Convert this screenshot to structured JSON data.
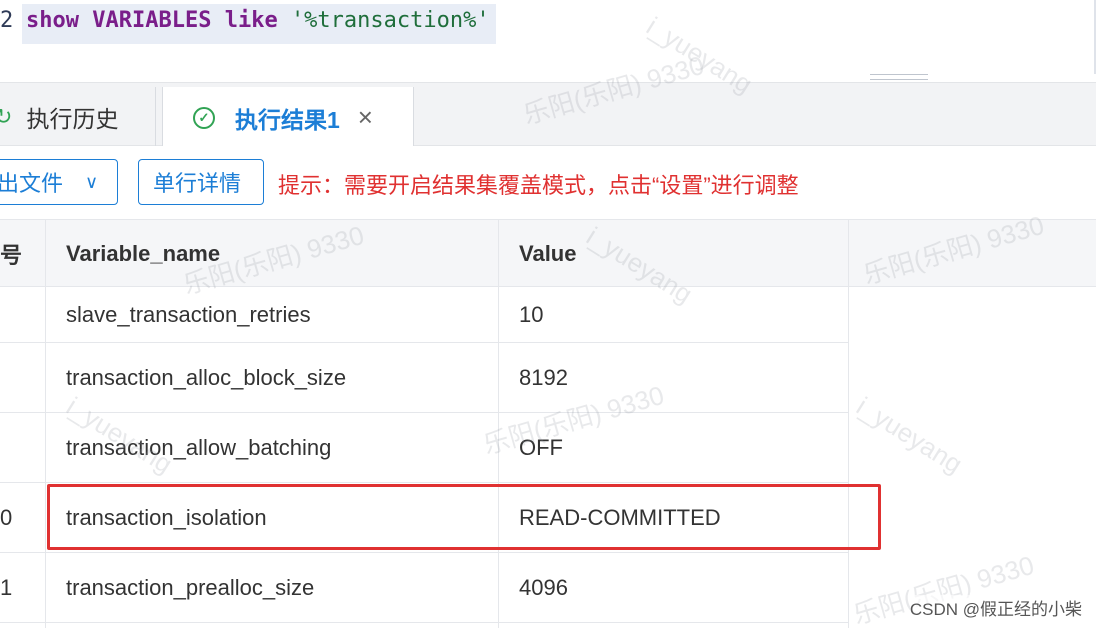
{
  "editor": {
    "line_number": "2",
    "code_keyword1": "show",
    "code_keyword2": "VARIABLES",
    "code_keyword3": "like",
    "code_string": "'%transaction%'"
  },
  "tabs": [
    {
      "label": "执行历史",
      "icon": "refresh-icon",
      "active": false
    },
    {
      "label": "执行结果1",
      "icon": "check-circle-icon",
      "active": true
    }
  ],
  "toolbar": {
    "export_label": "出文件",
    "detail_label": "单行详情",
    "hint": "提示：需要开启结果集覆盖模式，点击“设置”进行调整"
  },
  "table": {
    "columns": [
      "号",
      "Variable_name",
      "Value"
    ],
    "rows": [
      {
        "index": "",
        "name": "slave_transaction_retries",
        "value": "10"
      },
      {
        "index": "",
        "name": "transaction_alloc_block_size",
        "value": "8192"
      },
      {
        "index": "",
        "name": "transaction_allow_batching",
        "value": "OFF"
      },
      {
        "index": "0",
        "name": "transaction_isolation",
        "value": "READ-COMMITTED"
      },
      {
        "index": "1",
        "name": "transaction_prealloc_size",
        "value": "4096"
      }
    ],
    "highlighted_row": "transaction_isolation"
  },
  "watermarks": [
    "乐阳(乐阳) 9330",
    "i_yueyang"
  ],
  "credit": "CSDN @假正经的小柴",
  "colors": {
    "accent": "#1c7ed6",
    "hint": "#e03131",
    "success": "#31a354",
    "highlight_border": "#e03131"
  }
}
